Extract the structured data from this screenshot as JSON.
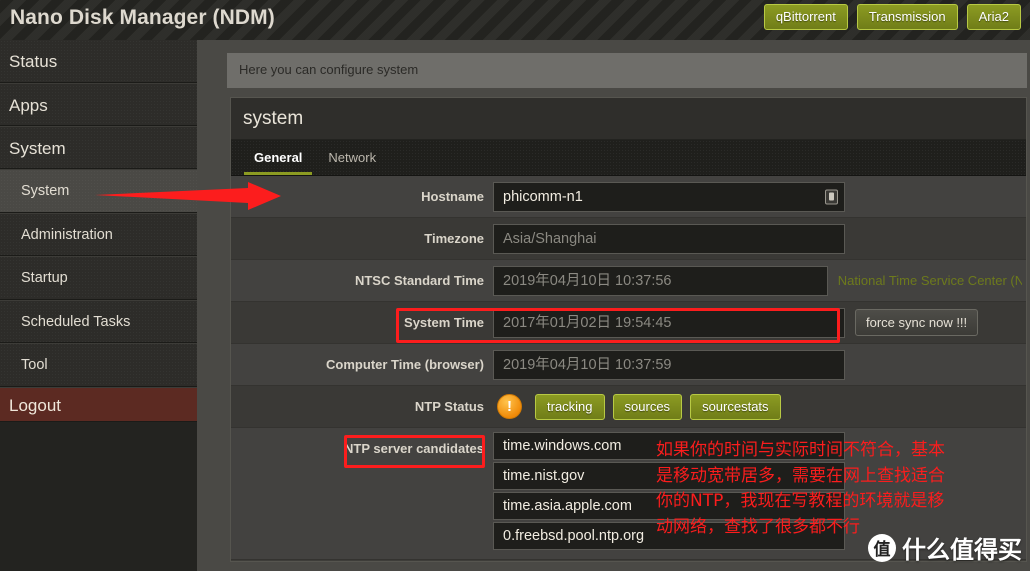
{
  "header": {
    "app_title": "Nano Disk Manager (NDM)",
    "buttons": [
      {
        "label": "qBittorrent"
      },
      {
        "label": "Transmission"
      },
      {
        "label": "Aria2"
      }
    ]
  },
  "sidebar": {
    "top_items": [
      {
        "label": "Status"
      },
      {
        "label": "Apps"
      },
      {
        "label": "System"
      }
    ],
    "sub_items": [
      {
        "label": "System",
        "active": true
      },
      {
        "label": "Administration",
        "active": false
      },
      {
        "label": "Startup",
        "active": false
      },
      {
        "label": "Scheduled Tasks",
        "active": false
      },
      {
        "label": "Tool",
        "active": false
      }
    ],
    "logout_label": "Logout"
  },
  "main": {
    "hint": "Here you can configure system",
    "panel_title": "system",
    "tabs": [
      {
        "label": "General",
        "active": true
      },
      {
        "label": "Network",
        "active": false
      }
    ],
    "form": {
      "hostname": {
        "label": "Hostname",
        "value": "phicomm-n1",
        "icon": "save-icon"
      },
      "timezone": {
        "label": "Timezone",
        "value": "Asia/Shanghai"
      },
      "ntsc_standard_time": {
        "label": "NTSC Standard Time",
        "value": "2019年04月10日 10:37:56",
        "note": "National Time Service Center (NT"
      },
      "system_time": {
        "label": "System Time",
        "value": "2017年01月02日 19:54:45",
        "action_label": "force sync now !!!"
      },
      "computer_time": {
        "label": "Computer Time (browser)",
        "value": "2019年04月10日 10:37:59"
      },
      "ntp_status": {
        "label": "NTP Status",
        "status_icon": "warning-icon",
        "status_glyph": "!",
        "buttons": [
          {
            "label": "tracking"
          },
          {
            "label": "sources"
          },
          {
            "label": "sourcestats"
          }
        ]
      },
      "ntp_candidates": {
        "label": "NTP server candidates",
        "servers": [
          "time.windows.com",
          "time.nist.gov",
          "time.asia.apple.com",
          "0.freebsd.pool.ntp.org"
        ]
      }
    }
  },
  "annotations": {
    "note_text": "如果你的时间与实际时间不符合，基本\n是移动宽带居多，需要在网上查找适合\n你的NTP，我现在写教程的环境就是移\n动网络，查找了很多都不行",
    "watermark_badge": "值",
    "watermark_text": "什么值得买",
    "accent_red": "#fc1d1d"
  }
}
